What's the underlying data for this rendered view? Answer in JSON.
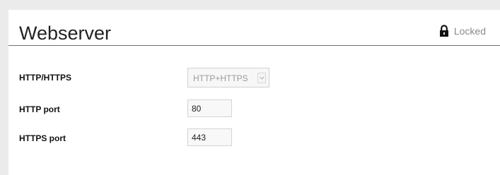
{
  "section": {
    "title": "Webserver",
    "lock_status": "Locked"
  },
  "form": {
    "protocol": {
      "label": "HTTP/HTTPS",
      "selected": "HTTP+HTTPS"
    },
    "http_port": {
      "label": "HTTP port",
      "value": "80"
    },
    "https_port": {
      "label": "HTTPS port",
      "value": "443"
    }
  },
  "icons": {
    "lock": "lock-icon",
    "dropdown": "chevron-down-icon"
  },
  "colors": {
    "background": "#ebebeb",
    "panel": "#ffffff",
    "locked_text": "#8a8a8a",
    "disabled_text": "#9a9a9a"
  }
}
